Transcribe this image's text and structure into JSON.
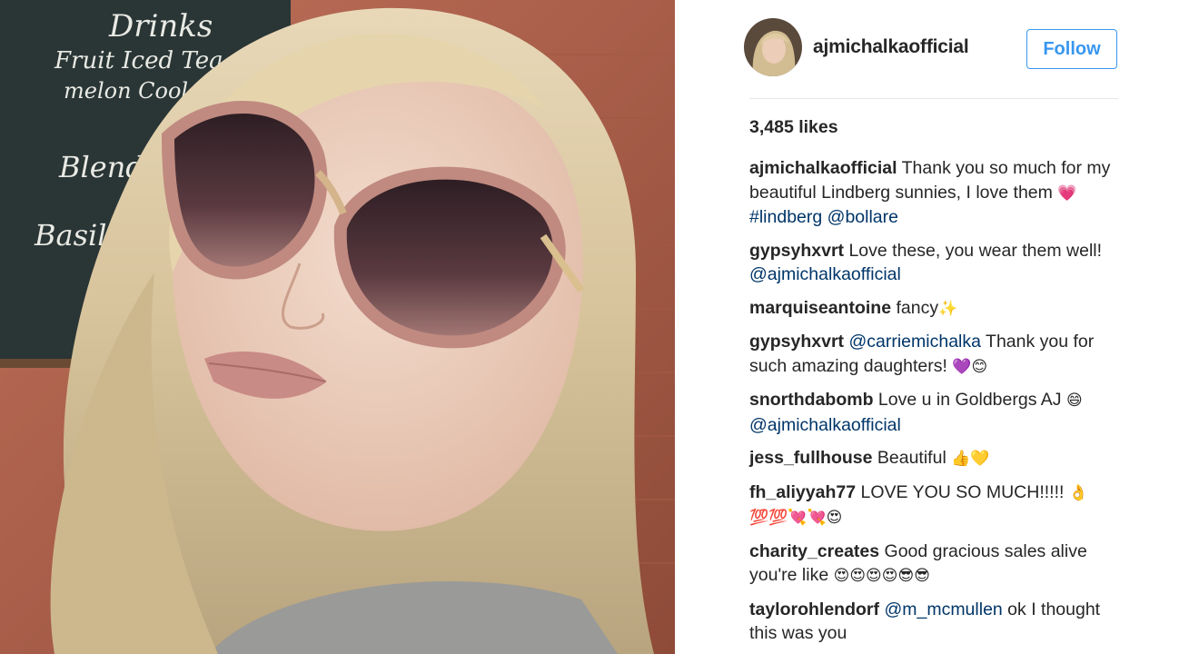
{
  "post": {
    "username": "ajmichalkaofficial",
    "follow_label": "Follow",
    "likes": "3,485 likes"
  },
  "photo": {
    "chalkboard_lines": [
      "Drinks",
      "Fruit Iced Tea",
      "melon Cooler",
      "Blend",
      "Basil"
    ]
  },
  "comments": [
    {
      "user": "ajmichalkaofficial",
      "text": " Thank you so much for my beautiful Lindberg sunnies, I love them ",
      "emoji": "💗",
      "tags": " #lindberg @bollare"
    },
    {
      "user": "gypsyhxvrt",
      "text": " Love these, you wear them well! ",
      "tags": "@ajmichalkaofficial"
    },
    {
      "user": "marquiseantoine",
      "text": " fancy",
      "emoji": "✨"
    },
    {
      "user": "gypsyhxvrt",
      "text_before_tag": " ",
      "tag_inline": "@carriemichalka",
      "text": " Thank you for such amazing daughters! ",
      "emoji": "💜😊"
    },
    {
      "user": "snorthdabomb",
      "text": " Love u in Goldbergs AJ ",
      "emoji": "😄",
      "tags": " @ajmichalkaofficial"
    },
    {
      "user": "jess_fullhouse",
      "text": " Beautiful ",
      "emoji": "👍💛"
    },
    {
      "user": "fh_aliyyah77",
      "text": " LOVE YOU SO MUCH!!!!! ",
      "emoji": "👌💯💯💘💘😍"
    },
    {
      "user": "charity_creates",
      "text": " Good gracious sales alive you're like ",
      "emoji": "😍😍😍😍😎😎"
    },
    {
      "user": "taylorohlendorf",
      "text_before_tag": " ",
      "tag_inline": "@m_mcmullen",
      "text": " ok I thought this was you"
    }
  ],
  "colors": {
    "accent": "#3897f0",
    "hashtag": "#003569",
    "text": "#262626",
    "divider": "#e6e6e6"
  },
  "icons": [
    "avatar-image",
    "photo-image"
  ]
}
